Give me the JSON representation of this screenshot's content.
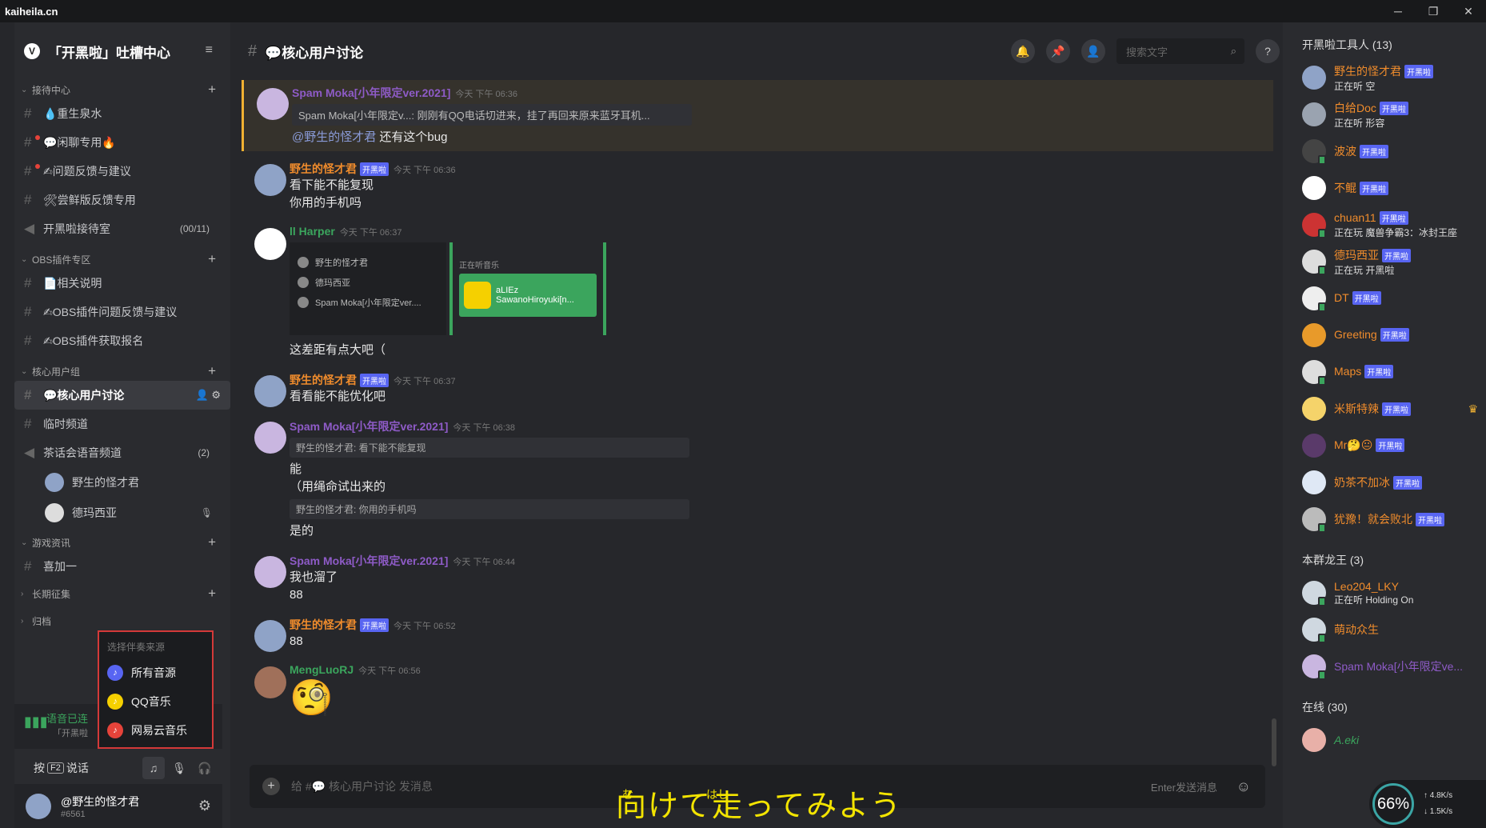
{
  "titlebar": {
    "host": "kaiheila.cn",
    "minimize": "─",
    "restore": "❐",
    "close": "✕"
  },
  "guild": {
    "badge": "V",
    "name": "「开黑啦」吐槽中心",
    "menu": "≡"
  },
  "sidebar": {
    "categories": [
      {
        "label": "接待中心",
        "channels": [
          {
            "label": "💧重生泉水"
          },
          {
            "label": "💬闲聊专用🔥"
          },
          {
            "label": "✍问题反馈与建议"
          },
          {
            "label": "🛠尝鲜版反馈专用"
          },
          {
            "label": "开黑啦接待室",
            "count": "(00/11)"
          }
        ]
      },
      {
        "label": "OBS插件专区",
        "channels": [
          {
            "label": "📄相关说明"
          },
          {
            "label": "✍OBS插件问题反馈与建议"
          },
          {
            "label": "✍OBS插件获取报名"
          }
        ]
      },
      {
        "label": "核心用户组",
        "channels": [
          {
            "label": "💬核心用户讨论"
          },
          {
            "label": "临时频道"
          },
          {
            "label": "茶话会语音频道",
            "count": "(2)"
          }
        ]
      },
      {
        "label": "游戏资讯",
        "channels": [
          {
            "label": "喜加一"
          }
        ]
      },
      {
        "label": "长期征集"
      },
      {
        "label": "归档"
      }
    ],
    "voice_users": [
      {
        "name": "野生的怪才君"
      },
      {
        "name": "德玛西亚"
      }
    ],
    "popup": {
      "title": "选择伴奏来源",
      "options": [
        {
          "label": "所有音源",
          "color": "#5865f2"
        },
        {
          "label": "QQ音乐",
          "color": "#f5d000"
        },
        {
          "label": "网易云音乐",
          "color": "#e6433a"
        }
      ]
    },
    "voice": {
      "status": "语音已连",
      "server": "「开黑啦"
    },
    "ptt": {
      "prefix": "按",
      "key": "F2",
      "suffix": "说话"
    },
    "self": {
      "name": "@野生的怪才君",
      "tag": "#6561"
    }
  },
  "channel": {
    "title": "💬核心用户讨论",
    "search_placeholder": "搜索文字"
  },
  "messages": [
    {
      "user": "Spam Moka[小年限定ver.2021]",
      "time": "今天 下午 06:36",
      "quote": "Spam Moka[小年限定v...: 刚刚有QQ电话切进来，挂了再回来原来蓝牙耳机...",
      "mention": "@野生的怪才君",
      "text": "还有这个bug"
    },
    {
      "user": "野生的怪才君",
      "badge": "开黑啦",
      "time": "今天 下午 06:36",
      "lines": [
        "看下能不能复现",
        "你用的手机吗"
      ]
    },
    {
      "user": "ll Harper",
      "time": "今天 下午 06:37",
      "embed": {
        "rows": [
          "野生的怪才君",
          "德玛西亚",
          "Spam Moka[小年限定ver...."
        ],
        "label": "正在听音乐",
        "track1": "aLIEz",
        "track2": "SawanoHiroyuki[n..."
      },
      "text": "这差距有点大吧（"
    },
    {
      "user": "野生的怪才君",
      "badge": "开黑啦",
      "time": "今天 下午 06:37",
      "text": "看看能不能优化吧"
    },
    {
      "user": "Spam Moka[小年限定ver.2021]",
      "time": "今天 下午 06:38",
      "quote1": "野生的怪才君: 看下能不能复现",
      "line1": "能",
      "line2": "（用绳命试出来的",
      "quote2": "野生的怪才君: 你用的手机吗",
      "line3": "是的"
    },
    {
      "user": "Spam Moka[小年限定ver.2021]",
      "time": "今天 下午 06:44",
      "lines": [
        "我也溜了",
        "88"
      ]
    },
    {
      "user": "野生的怪才君",
      "badge": "开黑啦",
      "time": "今天 下午 06:52",
      "text": "88"
    },
    {
      "user": "MengLuoRJ",
      "time": "今天 下午 06:56",
      "emoji": "🧐"
    }
  ],
  "composer": {
    "placeholder": "给 #💬 核心用户讨论 发消息",
    "hint": "Enter发送消息"
  },
  "members": {
    "groups": [
      {
        "title": "开黑啦工具人 (13)",
        "items": [
          {
            "name": "野生的怪才君",
            "badge": "开黑啦",
            "activity": "正在听 空"
          },
          {
            "name": "白给Doc",
            "badge": "开黑啦",
            "activity": "正在听 形容"
          },
          {
            "name": "波波",
            "badge": "开黑啦"
          },
          {
            "name": "不鲲",
            "badge": "开黑啦"
          },
          {
            "name": "chuan11",
            "badge": "开黑啦",
            "activity": "正在玩 魔兽争霸3：冰封王座"
          },
          {
            "name": "德玛西亚",
            "badge": "开黑啦",
            "activity": "正在玩 开黑啦"
          },
          {
            "name": "DT",
            "badge": "开黑啦"
          },
          {
            "name": "Greeting",
            "badge": "开黑啦"
          },
          {
            "name": "Maps",
            "badge": "开黑啦"
          },
          {
            "name": "米斯特辣",
            "badge": "开黑啦"
          },
          {
            "name": "Mr🤔😐",
            "badge": "开黑啦"
          },
          {
            "name": "奶茶不加冰",
            "badge": "开黑啦"
          },
          {
            "name": "犹豫！就会败北",
            "badge": "开黑啦"
          }
        ]
      },
      {
        "title": "本群龙王 (3)",
        "items": [
          {
            "name": "Leo204_LKY",
            "activity": "正在听 Holding On"
          },
          {
            "name": "萌动众生"
          },
          {
            "name": "Spam Moka[小年限定ve..."
          }
        ]
      },
      {
        "title": "在线 (30)",
        "items": [
          {
            "name": "A.eki"
          }
        ]
      }
    ]
  },
  "overlay": {
    "subtitle": "向けて走ってみよう",
    "ruby1": "む",
    "ruby2": "はし",
    "percent": "66%",
    "up": "↑ 4.8K/s",
    "down": "↓ 1.5K/s"
  }
}
